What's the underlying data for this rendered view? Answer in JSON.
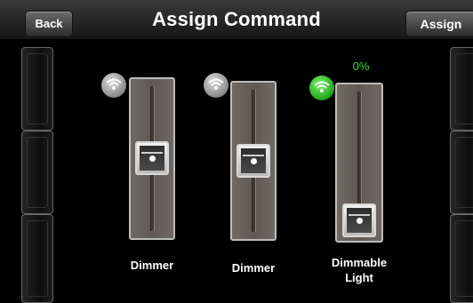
{
  "header": {
    "title": "Assign Command",
    "back_label": "Back",
    "assign_label": "Assign"
  },
  "devices": [
    {
      "name": "Dimmer",
      "icon": "wifi-icon",
      "connected": false,
      "level_percent": 50
    },
    {
      "name": "Dimmer",
      "icon": "wifi-icon",
      "connected": false,
      "level_percent": 50
    },
    {
      "name": "Dimmable Light",
      "name_line1": "Dimmable",
      "name_line2": "Light",
      "icon": "wifi-icon",
      "connected": true,
      "level_percent": 0,
      "level_text": "0%"
    }
  ],
  "colors": {
    "connected": "#2fae22",
    "disconnected": "#9a9a9a",
    "level_text": "#3bd33b"
  }
}
